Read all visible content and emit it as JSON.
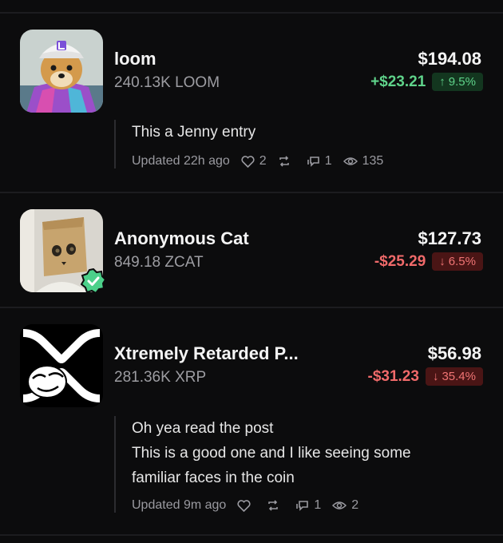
{
  "colors": {
    "background": "#0c0c0d",
    "positive": "#5fd38a",
    "negative": "#f06a6a",
    "verified": "#4cd08a"
  },
  "holdings": [
    {
      "name": "loom",
      "amount": "240.13K LOOM",
      "value": "$194.08",
      "change": "+$23.21",
      "direction": "up",
      "percent": "9.5%",
      "arrow": "↑",
      "verified": false,
      "post": {
        "lines": [
          "This a Jenny entry"
        ],
        "updated": "Updated 22h ago",
        "likes": "2",
        "reposts": "",
        "comments": "1",
        "views": "135"
      }
    },
    {
      "name": "Anonymous Cat",
      "amount": "849.18 ZCAT",
      "value": "$127.73",
      "change": "-$25.29",
      "direction": "down",
      "percent": "6.5%",
      "arrow": "↓",
      "verified": true
    },
    {
      "name": "Xtremely Retarded P...",
      "amount": "281.36K XRP",
      "value": "$56.98",
      "change": "-$31.23",
      "direction": "down",
      "percent": "35.4%",
      "arrow": "↓",
      "verified": false,
      "post": {
        "lines": [
          "Oh yea read the post",
          "This is a good one and I like seeing some",
          "familiar faces in the coin"
        ],
        "updated": "Updated 9m ago",
        "likes": "",
        "reposts": "",
        "comments": "1",
        "views": "2"
      }
    }
  ]
}
